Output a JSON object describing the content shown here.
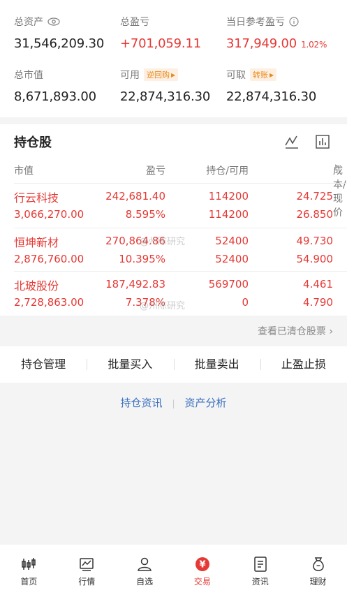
{
  "summary": {
    "total_assets_label": "总资产",
    "total_assets": "31,546,209.30",
    "total_pnl_label": "总盈亏",
    "total_pnl": "+701,059.11",
    "today_pnl_label": "当日参考盈亏",
    "today_pnl": "317,949.00",
    "today_pnl_pct": "1.02%",
    "market_value_label": "总市值",
    "market_value": "8,671,893.00",
    "available_label": "可用",
    "available_tag": "逆回购",
    "available": "22,874,316.30",
    "withdrawable_label": "可取",
    "withdrawable_tag": "转账",
    "withdrawable": "22,874,316.30"
  },
  "holdings": {
    "title": "持仓股",
    "columns": [
      "市值",
      "盈亏",
      "持仓/可用",
      "成本/现价"
    ],
    "rows": [
      {
        "name": "行云科技",
        "market_value": "3,066,270.00",
        "pnl": "242,681.40",
        "pnl_pct": "8.595%",
        "position": "114200",
        "available": "114200",
        "cost": "24.725",
        "price": "26.850"
      },
      {
        "name": "恒坤新材",
        "market_value": "2,876,760.00",
        "pnl": "270,864.86",
        "pnl_pct": "10.395%",
        "position": "52400",
        "available": "52400",
        "cost": "49.730",
        "price": "54.900"
      },
      {
        "name": "北玻股份",
        "market_value": "2,728,863.00",
        "pnl": "187,492.83",
        "pnl_pct": "7.378%",
        "position": "569700",
        "available": "0",
        "cost": "4.461",
        "price": "4.790"
      }
    ],
    "watermark": "@州陈研究"
  },
  "cleared_link": "查看已清仓股票 ›",
  "actions": [
    "持仓管理",
    "批量买入",
    "批量卖出",
    "止盈止损"
  ],
  "links": {
    "left": "持仓资讯",
    "sep": "|",
    "right": "资产分析"
  },
  "tabs": [
    {
      "label": "首页",
      "icon": "home-candlestick-icon"
    },
    {
      "label": "行情",
      "icon": "market-chart-icon"
    },
    {
      "label": "自选",
      "icon": "watchlist-person-icon"
    },
    {
      "label": "交易",
      "icon": "trade-yen-icon",
      "active": true
    },
    {
      "label": "资讯",
      "icon": "news-document-icon"
    },
    {
      "label": "理财",
      "icon": "wealth-bag-icon"
    }
  ],
  "colors": {
    "accent": "#e53935",
    "link": "#3a6fbf",
    "tag": "#e88a1a"
  }
}
